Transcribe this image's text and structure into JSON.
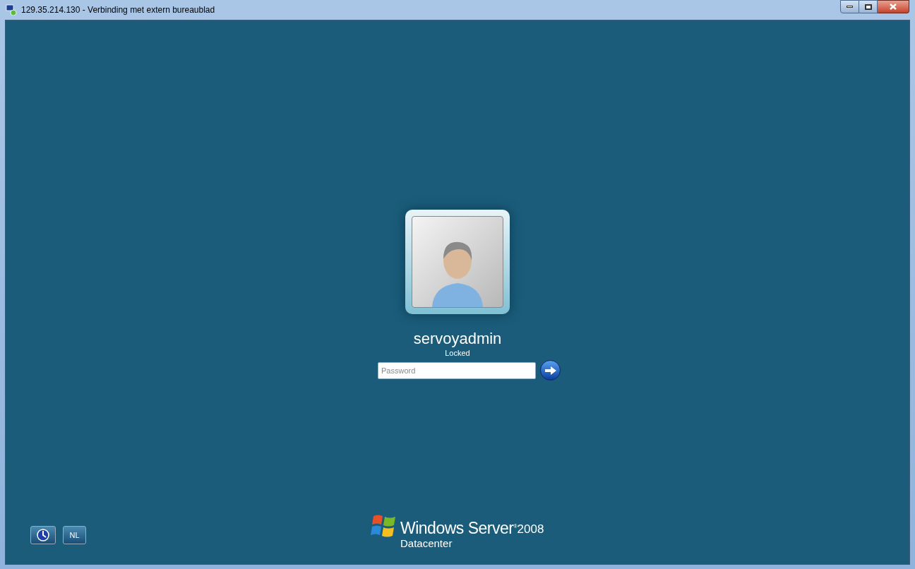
{
  "window": {
    "title": "129.35.214.130 - Verbinding met extern bureaublad"
  },
  "user": {
    "name": "servoyadmin",
    "status": "Locked"
  },
  "password": {
    "placeholder": "Password"
  },
  "language_button": "NL",
  "branding": {
    "product": "Windows Server",
    "mark": "®",
    "version": "2008",
    "edition": "Datacenter"
  }
}
